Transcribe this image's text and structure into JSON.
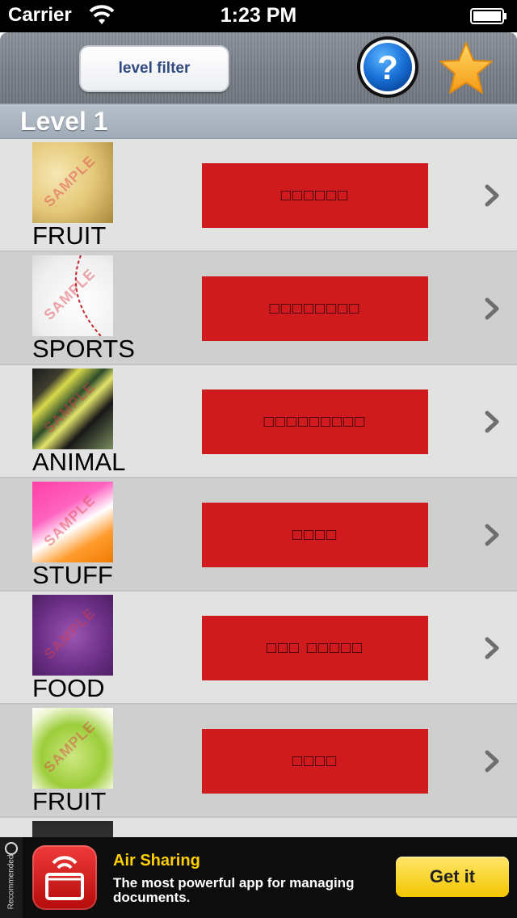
{
  "status_bar": {
    "carrier": "Carrier",
    "time": "1:23 PM"
  },
  "nav": {
    "filter_label": "level filter",
    "help_icon": "question-mark-icon",
    "favorite_icon": "star-icon"
  },
  "section": {
    "title": "Level 1"
  },
  "watermark": "SAMPLE",
  "rows": [
    {
      "category": "FRUIT",
      "answer": "□□□□□□",
      "thumb": "fruit-image"
    },
    {
      "category": "SPORTS",
      "answer": "□□□□□□□□",
      "thumb": "baseball-image"
    },
    {
      "category": "ANIMAL",
      "answer": "□□□□□□□□□",
      "thumb": "butterfly-image"
    },
    {
      "category": "STUFF",
      "answer": "□□□□",
      "thumb": "gift-image"
    },
    {
      "category": "FOOD",
      "answer": "□□□ □□□□□",
      "thumb": "purple-food-image"
    },
    {
      "category": "FRUIT",
      "answer": "□□□□",
      "thumb": "lime-image"
    }
  ],
  "ad": {
    "badge": "Recommended",
    "title": "Air Sharing",
    "description": "The most powerful app for managing documents.",
    "button": "Get it"
  },
  "colors": {
    "answer_box": "#cf1a1e",
    "ad_title": "#ffcf00",
    "ad_button": "#f3c600"
  }
}
